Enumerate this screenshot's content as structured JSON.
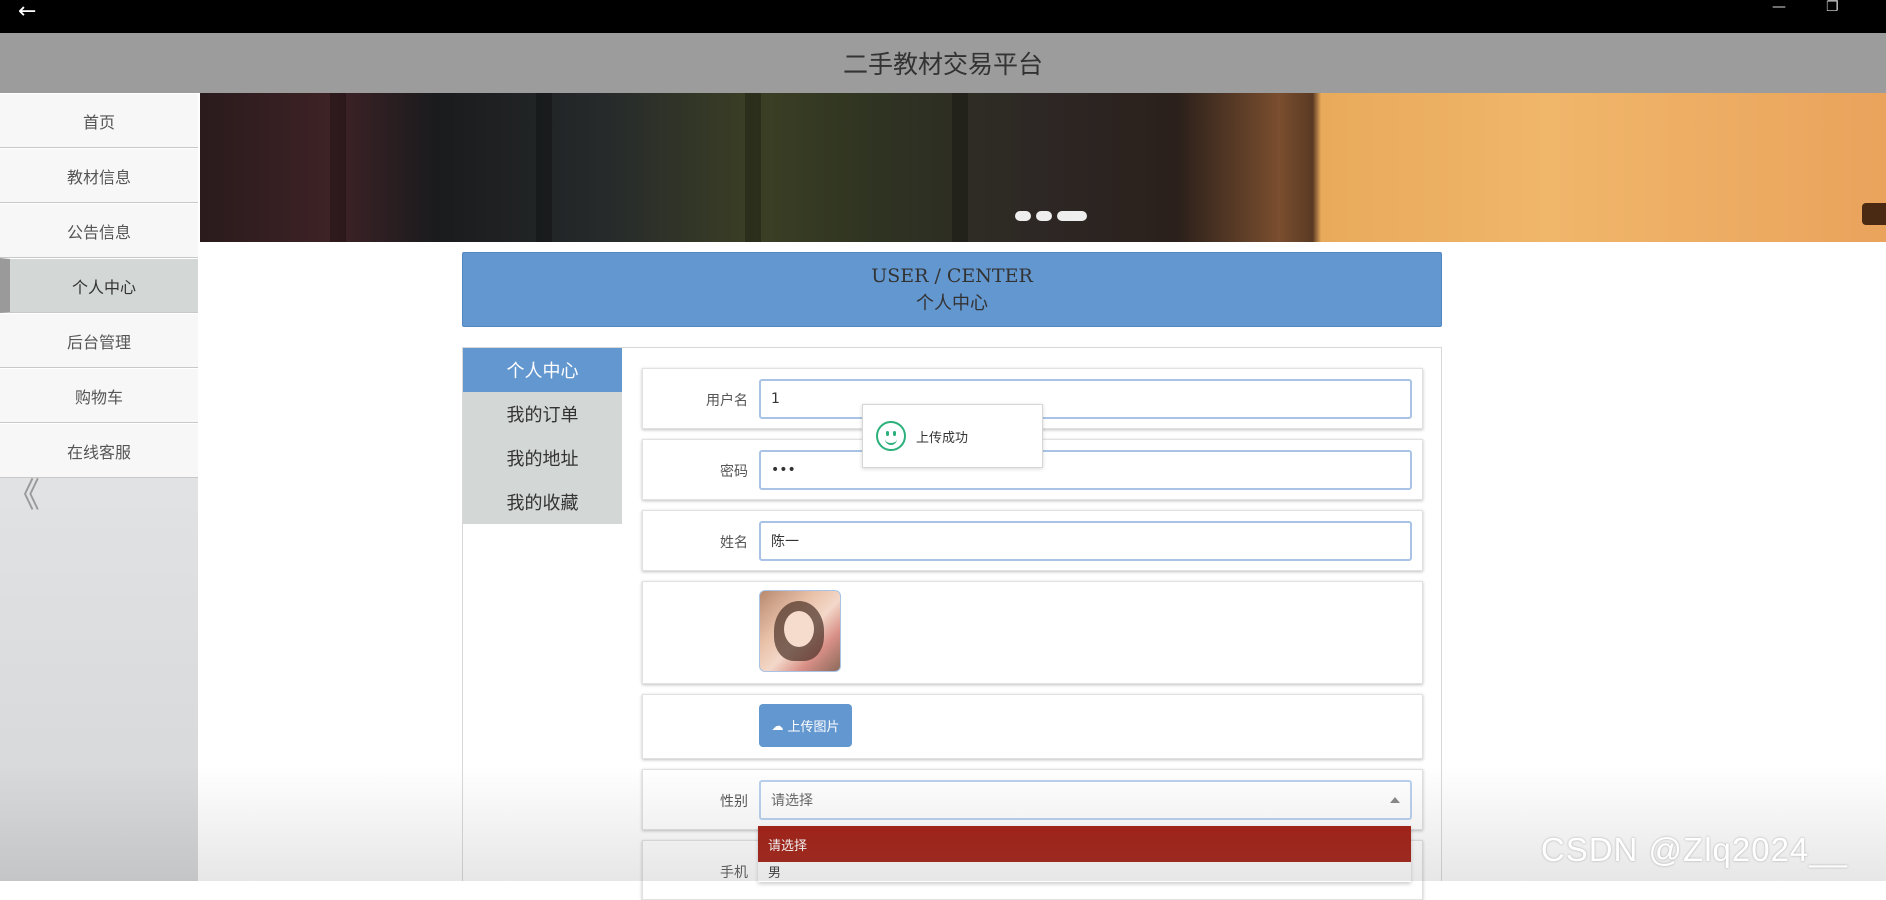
{
  "window": {
    "back_glyph": "←",
    "minimize_glyph": "—",
    "restore_glyph": "❐"
  },
  "header": {
    "title": "二手教材交易平台"
  },
  "sidebar": {
    "items": [
      {
        "label": "首页",
        "active": false
      },
      {
        "label": "教材信息",
        "active": false
      },
      {
        "label": "公告信息",
        "active": false
      },
      {
        "label": "个人中心",
        "active": true
      },
      {
        "label": "后台管理",
        "active": false
      },
      {
        "label": "购物车",
        "active": false
      },
      {
        "label": "在线客服",
        "active": false
      }
    ],
    "collapse_glyph": "《"
  },
  "banner": {
    "indicator_count": 3,
    "active_indicator": 3
  },
  "user_center": {
    "title_en": "USER / CENTER",
    "title_zh": "个人中心"
  },
  "tabs": [
    {
      "label": "个人中心",
      "active": true
    },
    {
      "label": "我的订单",
      "active": false
    },
    {
      "label": "我的地址",
      "active": false
    },
    {
      "label": "我的收藏",
      "active": false
    }
  ],
  "form": {
    "username": {
      "label": "用户名",
      "value": "1"
    },
    "password": {
      "label": "密码",
      "value": "•••"
    },
    "name": {
      "label": "姓名",
      "value": "陈一"
    },
    "upload_button": "上传图片",
    "gender": {
      "label": "性别",
      "placeholder": "请选择"
    },
    "phone": {
      "label": "手机"
    }
  },
  "dropdown": {
    "options": [
      "请选择",
      "男"
    ],
    "selected": "请选择"
  },
  "toast": {
    "message": "上传成功"
  },
  "watermark": "CSDN @Zlq2024__",
  "colors": {
    "accent": "#6397d0",
    "dropdown_selected": "#a21b10",
    "toast_icon": "#2bb07c",
    "header_bg": "#9c9c9c"
  }
}
